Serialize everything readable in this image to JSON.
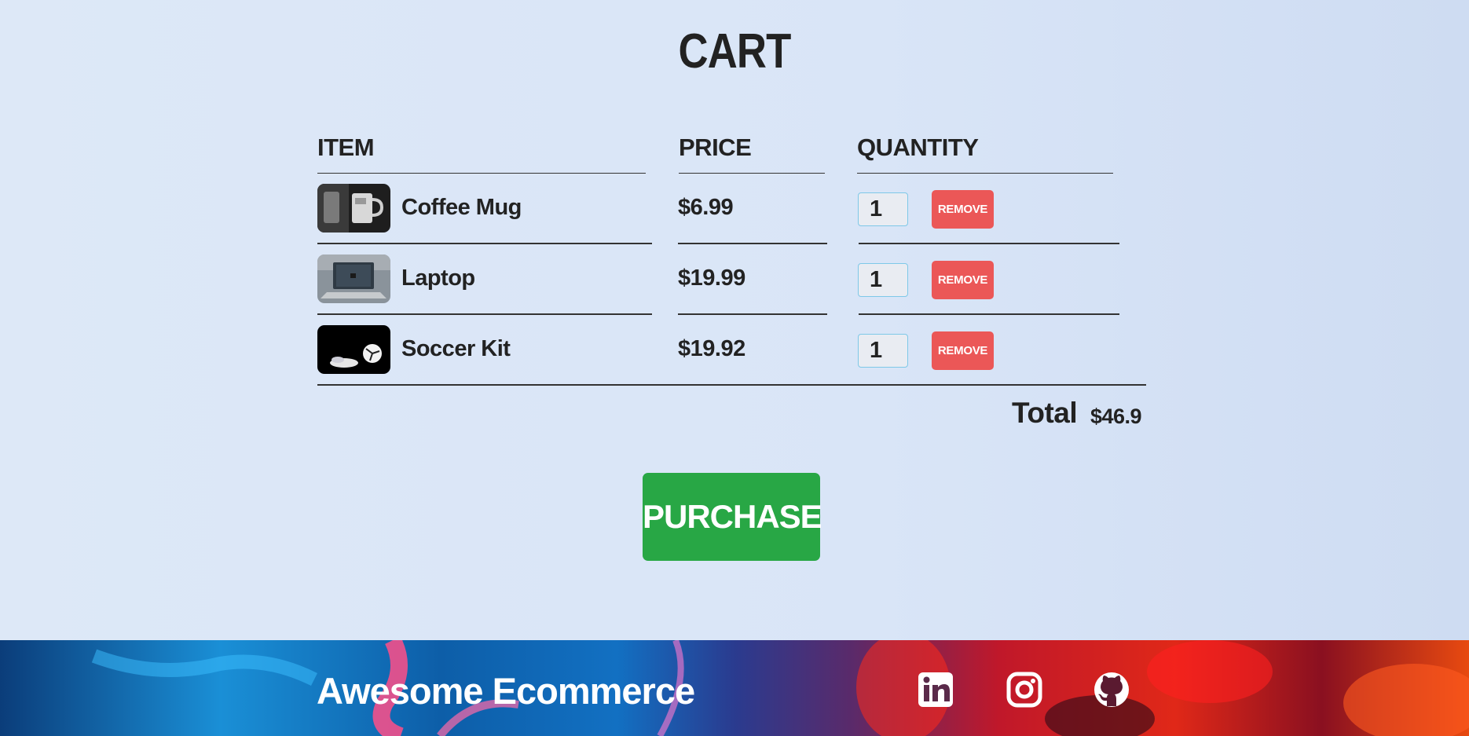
{
  "page": {
    "title": "CART"
  },
  "table": {
    "headers": {
      "item": "ITEM",
      "price": "PRICE",
      "quantity": "QUANTITY"
    },
    "rows": [
      {
        "name": "Coffee Mug",
        "price": "$6.99",
        "quantity": "1",
        "remove_label": "REMOVE",
        "image": "coffee-mug-photo"
      },
      {
        "name": "Laptop",
        "price": "$19.99",
        "quantity": "1",
        "remove_label": "REMOVE",
        "image": "laptop-photo"
      },
      {
        "name": "Soccer Kit",
        "price": "$19.92",
        "quantity": "1",
        "remove_label": "REMOVE",
        "image": "soccer-kit-photo"
      }
    ]
  },
  "total": {
    "label": "Total",
    "value": "$46.9"
  },
  "purchase": {
    "label": "PURCHASE"
  },
  "footer": {
    "brand": "Awesome Ecommerce",
    "social": [
      "linkedin-icon",
      "instagram-icon",
      "github-icon"
    ]
  },
  "colors": {
    "purchase": "#28a745",
    "remove": "#eb5757",
    "quantity_border": "#7ec8e8",
    "text": "#222222"
  }
}
